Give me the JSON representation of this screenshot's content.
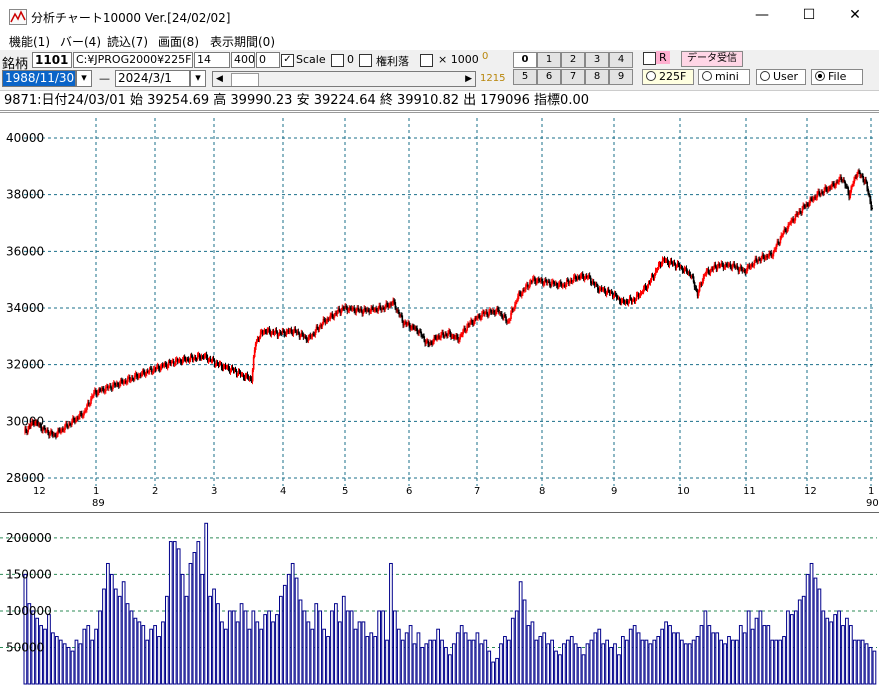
{
  "window": {
    "title": "分析チャート10000 Ver.[24/02/02]"
  },
  "menu": [
    "機能(1)",
    "バー(4)",
    "読込(7)",
    "画面(8)",
    "表示期間(0)"
  ],
  "toolbar": {
    "code_label": "銘柄",
    "code": "1101",
    "path": "C:¥JPROG2000¥225F",
    "field1": "14",
    "field2": "4000",
    "field3": "0",
    "scale_label": "Scale",
    "zero_label": "0",
    "kenri_label": "権利落",
    "x1000_label": "× 1000",
    "small_zero": "0",
    "start_date": "1988/11/30",
    "end_date": "2024/3/1",
    "count": "1215",
    "num_buttons": [
      "0",
      "1",
      "2",
      "3",
      "4",
      "5",
      "6",
      "7",
      "8",
      "9"
    ],
    "r_label": "R",
    "data_recv_label": "データ受信",
    "radios": [
      "225F",
      "mini",
      "User",
      "File"
    ],
    "radio_selected": "File"
  },
  "info_line": "9871:日付24/03/01 始 39254.69 高 39990.23 安 39224.64 終 39910.82 出 179096 指標0.00",
  "colors": {
    "up": "#ff0000",
    "down": "#000000",
    "volume": "#00008b",
    "grid": "#1a6f8a",
    "volgrid": "#2e8b57"
  },
  "chart_data": {
    "type": "candlestick",
    "price_ylim": [
      28000,
      40000
    ],
    "price_yticks": [
      28000,
      30000,
      32000,
      34000,
      36000,
      38000,
      40000
    ],
    "x_ticks": [
      "12",
      "1",
      "2",
      "3",
      "4",
      "5",
      "6",
      "7",
      "8",
      "9",
      "10",
      "11",
      "12",
      "1"
    ],
    "x_year_labels": [
      "89",
      "90"
    ],
    "close_path": [
      [
        0,
        29600
      ],
      [
        10,
        30000
      ],
      [
        20,
        29700
      ],
      [
        30,
        29500
      ],
      [
        45,
        29900
      ],
      [
        60,
        30300
      ],
      [
        70,
        31000
      ],
      [
        85,
        31200
      ],
      [
        100,
        31400
      ],
      [
        120,
        31700
      ],
      [
        135,
        31900
      ],
      [
        150,
        32100
      ],
      [
        165,
        32200
      ],
      [
        180,
        32300
      ],
      [
        195,
        32000
      ],
      [
        210,
        31800
      ],
      [
        220,
        31600
      ],
      [
        228,
        31500
      ],
      [
        232,
        32800
      ],
      [
        240,
        33200
      ],
      [
        255,
        33100
      ],
      [
        270,
        33200
      ],
      [
        285,
        32900
      ],
      [
        300,
        33500
      ],
      [
        320,
        34000
      ],
      [
        340,
        33900
      ],
      [
        360,
        34000
      ],
      [
        370,
        34200
      ],
      [
        380,
        33500
      ],
      [
        395,
        33200
      ],
      [
        405,
        32700
      ],
      [
        415,
        33000
      ],
      [
        425,
        33100
      ],
      [
        435,
        32900
      ],
      [
        445,
        33400
      ],
      [
        460,
        33800
      ],
      [
        475,
        33900
      ],
      [
        485,
        33500
      ],
      [
        495,
        34400
      ],
      [
        510,
        35000
      ],
      [
        525,
        34900
      ],
      [
        540,
        34800
      ],
      [
        555,
        35100
      ],
      [
        565,
        35100
      ],
      [
        575,
        34700
      ],
      [
        590,
        34500
      ],
      [
        600,
        34200
      ],
      [
        612,
        34300
      ],
      [
        625,
        34800
      ],
      [
        640,
        35700
      ],
      [
        655,
        35500
      ],
      [
        668,
        35200
      ],
      [
        675,
        34500
      ],
      [
        682,
        35200
      ],
      [
        695,
        35500
      ],
      [
        710,
        35500
      ],
      [
        722,
        35300
      ],
      [
        735,
        35700
      ],
      [
        750,
        35900
      ],
      [
        760,
        36600
      ],
      [
        770,
        37100
      ],
      [
        780,
        37500
      ],
      [
        795,
        38000
      ],
      [
        810,
        38300
      ],
      [
        820,
        38600
      ],
      [
        827,
        38000
      ],
      [
        835,
        38800
      ],
      [
        843,
        38500
      ],
      [
        850,
        37500
      ]
    ],
    "volume_ylim": [
      0,
      230000
    ],
    "volume_yticks": [
      50000,
      100000,
      150000,
      200000
    ],
    "volumes": [
      150,
      110,
      100,
      90,
      80,
      75,
      95,
      70,
      65,
      60,
      55,
      50,
      45,
      60,
      55,
      75,
      80,
      60,
      75,
      100,
      130,
      165,
      150,
      130,
      120,
      140,
      110,
      100,
      90,
      85,
      80,
      60,
      75,
      80,
      65,
      85,
      120,
      195,
      195,
      185,
      150,
      120,
      165,
      180,
      195,
      150,
      220,
      120,
      130,
      110,
      85,
      75,
      100,
      100,
      85,
      110,
      100,
      75,
      100,
      85,
      75,
      95,
      100,
      85,
      95,
      120,
      135,
      150,
      165,
      145,
      115,
      100,
      85,
      75,
      110,
      100,
      75,
      65,
      100,
      110,
      85,
      120,
      100,
      100,
      75,
      85,
      85,
      65,
      70,
      65,
      100,
      100,
      60,
      165,
      100,
      75,
      60,
      70,
      80,
      55,
      70,
      50,
      55,
      60,
      60,
      75,
      60,
      50,
      40,
      55,
      70,
      80,
      70,
      60,
      60,
      70,
      55,
      60,
      45,
      30,
      35,
      55,
      65,
      60,
      90,
      100,
      140,
      115,
      80,
      85,
      60,
      65,
      70,
      55,
      60,
      45,
      40,
      55,
      60,
      65,
      55,
      50,
      40,
      55,
      60,
      70,
      75,
      55,
      60,
      50,
      55,
      40,
      65,
      60,
      75,
      80,
      70,
      60,
      60,
      55,
      60,
      65,
      75,
      85,
      80,
      70,
      70,
      60,
      55,
      55,
      60,
      65,
      80,
      100,
      80,
      70,
      70,
      60,
      55,
      65,
      60,
      60,
      80,
      70,
      100,
      75,
      90,
      100,
      80,
      80,
      60,
      60,
      60,
      65,
      100,
      95,
      100,
      115,
      120,
      150,
      165,
      145,
      130,
      100,
      90,
      85,
      95,
      100,
      80,
      90,
      80,
      60,
      60,
      60,
      55,
      50,
      45
    ]
  }
}
